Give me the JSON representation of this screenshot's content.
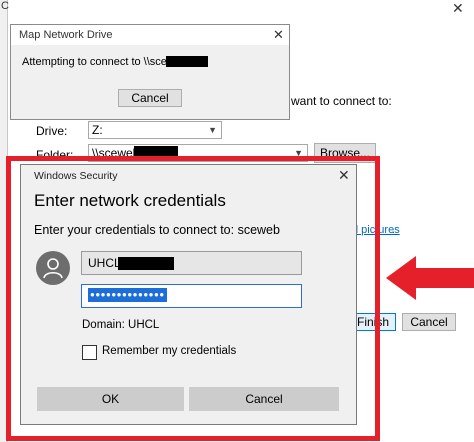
{
  "background_window": {
    "left_clip_text": "C",
    "prompt_suffix": "want to connect to:",
    "drive_label": "Drive:",
    "drive_value": "Z:",
    "folder_label": "Folder:",
    "folder_value": "\\\\sceweb\\",
    "browse_label": "Browse...",
    "link_fragment": "d pictures",
    "finish_label": "Finish",
    "cancel_label": "Cancel"
  },
  "attempt_dialog": {
    "title": "Map Network Drive",
    "message": "Attempting to connect to \\\\sceweb\\",
    "cancel_label": "Cancel"
  },
  "security_dialog": {
    "title": "Windows Security",
    "heading": "Enter network credentials",
    "prompt": "Enter your credentials to connect to: sceweb",
    "username_value": "UHCL\\",
    "password_mask": "●●●●●●●●●●●●●●",
    "domain_text": "Domain: UHCL",
    "remember_label": "Remember my credentials",
    "ok_label": "OK",
    "cancel_label": "Cancel"
  },
  "colors": {
    "highlight": "#e5202a",
    "selection": "#1d6ed8"
  },
  "icons": {
    "close": "close-icon",
    "dropdown": "chevron-down-icon",
    "user": "user-icon",
    "arrow": "arrow-left-icon"
  }
}
